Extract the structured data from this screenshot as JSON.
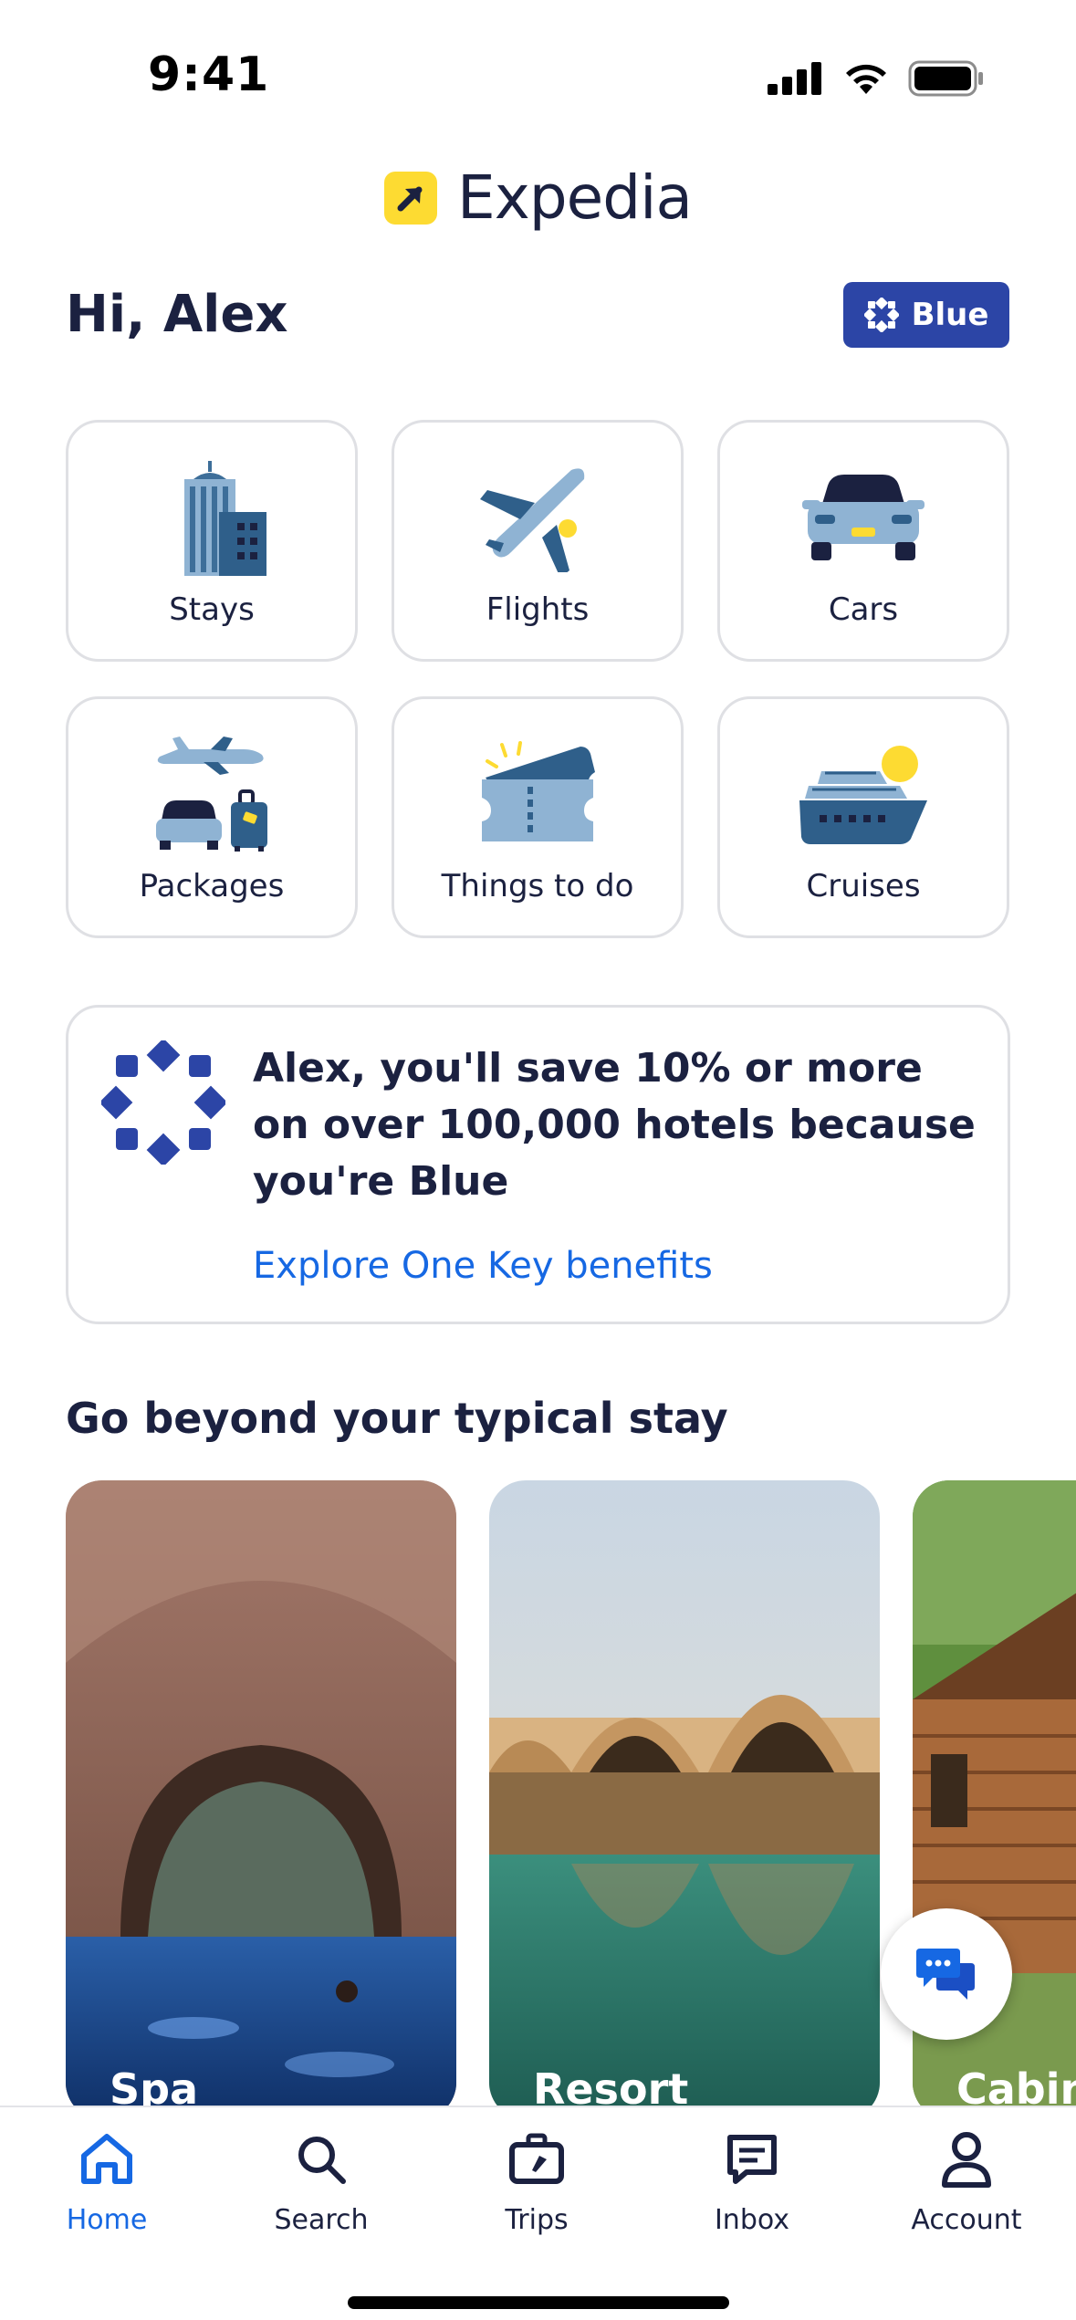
{
  "status_bar": {
    "time": "9:41",
    "icons": [
      "signal-icon",
      "wifi-icon",
      "battery-icon"
    ]
  },
  "app": {
    "logo_text": "Expedia",
    "brand_color": "#fddb32"
  },
  "greeting": "Hi, Alex",
  "tier_badge": {
    "label": "Blue",
    "color": "#2c45a6"
  },
  "categories": [
    {
      "label": "Stays",
      "icon": "stays-icon"
    },
    {
      "label": "Flights",
      "icon": "flights-icon"
    },
    {
      "label": "Cars",
      "icon": "cars-icon"
    },
    {
      "label": "Packages",
      "icon": "packages-icon"
    },
    {
      "label": "Things to do",
      "icon": "things-to-do-icon"
    },
    {
      "label": "Cruises",
      "icon": "cruises-icon"
    }
  ],
  "onekey": {
    "message": "Alex, you'll save 10% or more on over 100,000 hotels because you're Blue",
    "link": "Explore One Key benefits",
    "link_color": "#1668e3"
  },
  "section": {
    "title": "Go beyond your typical stay",
    "cards": [
      {
        "label": "Spa"
      },
      {
        "label": "Resort"
      },
      {
        "label": "Cabin"
      }
    ]
  },
  "bottom_nav": [
    {
      "label": "Home",
      "icon": "home-icon",
      "active": true
    },
    {
      "label": "Search",
      "icon": "search-icon",
      "active": false
    },
    {
      "label": "Trips",
      "icon": "trips-icon",
      "active": false
    },
    {
      "label": "Inbox",
      "icon": "inbox-icon",
      "active": false
    },
    {
      "label": "Account",
      "icon": "account-icon",
      "active": false
    }
  ],
  "accent_color": "#1668e3"
}
